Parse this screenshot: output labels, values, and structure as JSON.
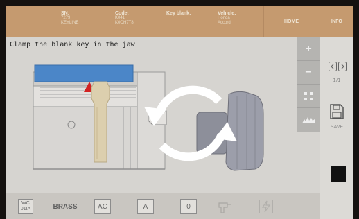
{
  "header": {
    "sn_label": "SN:",
    "sn_values": [
      "7279",
      "KEYLINE"
    ],
    "code_label": "Code:",
    "code_values": [
      "K041",
      "K0OH7T8"
    ],
    "key_blank_label": "Key blank:",
    "vehicle_label": "Vehicle:",
    "vehicle_values": [
      "Honda",
      "Accord"
    ],
    "home_label": "HOME",
    "info_label": "INFO"
  },
  "instruction": "Clamp the blank key in the jaw",
  "zoom": {
    "zoom_in_icon": "plus-icon",
    "zoom_out_icon": "minus-icon",
    "fit_icon": "grid-icon",
    "key_icon": "key-profile-icon"
  },
  "pager": {
    "label": "1/1",
    "icon": "page-arrows-icon"
  },
  "save": {
    "label": "SAVE",
    "icon": "floppy-disk-icon"
  },
  "footer": {
    "wc_label_line1": "WC",
    "wc_label_line2": "01IA",
    "material_label": "BRASS",
    "ac_label": "AC",
    "a_label": "A",
    "zero_label": "0"
  },
  "colors": {
    "header": "#c59a6f",
    "blue_jaw": "#4b86c8",
    "red_marker": "#d22222",
    "key_blank": "#dccfae"
  }
}
